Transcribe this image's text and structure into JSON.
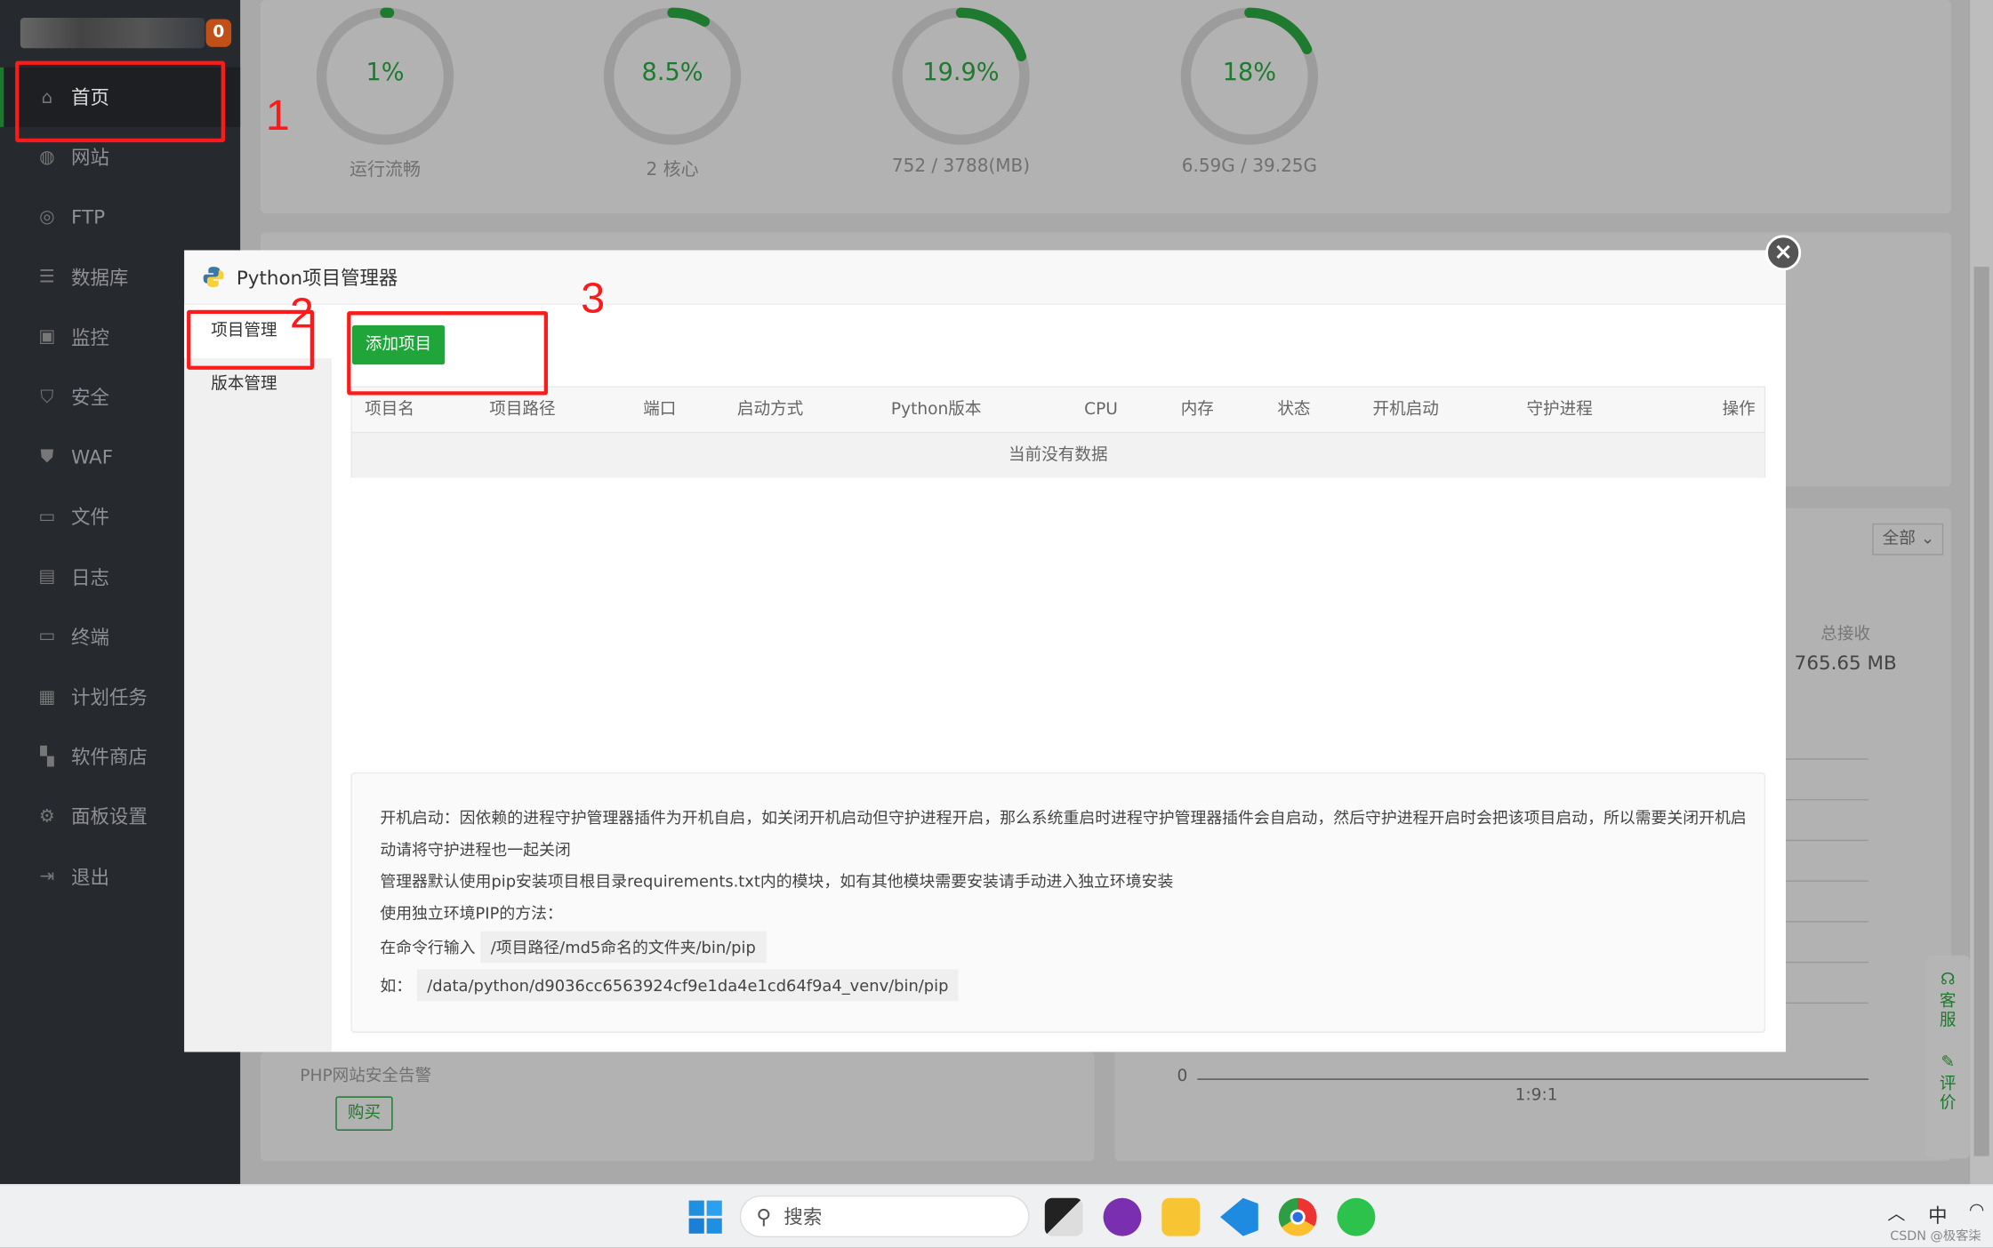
{
  "sidebar": {
    "badge": "0",
    "items": [
      {
        "label": "首页",
        "icon": "home-icon",
        "active": true
      },
      {
        "label": "网站",
        "icon": "globe-icon"
      },
      {
        "label": "FTP",
        "icon": "ftp-icon"
      },
      {
        "label": "数据库",
        "icon": "database-icon"
      },
      {
        "label": "监控",
        "icon": "monitor-icon"
      },
      {
        "label": "安全",
        "icon": "shield-icon"
      },
      {
        "label": "WAF",
        "icon": "waf-icon"
      },
      {
        "label": "文件",
        "icon": "folder-icon"
      },
      {
        "label": "日志",
        "icon": "log-icon"
      },
      {
        "label": "终端",
        "icon": "terminal-icon"
      },
      {
        "label": "计划任务",
        "icon": "calendar-icon"
      },
      {
        "label": "软件商店",
        "icon": "apps-icon"
      },
      {
        "label": "面板设置",
        "icon": "gear-icon"
      },
      {
        "label": "退出",
        "icon": "logout-icon"
      }
    ]
  },
  "gauges": [
    {
      "value": "1%",
      "percent": 1,
      "label": "运行流畅"
    },
    {
      "value": "8.5%",
      "percent": 8.5,
      "label": "2 核心"
    },
    {
      "value": "19.9%",
      "percent": 19.9,
      "label": "752 / 3788(MB)"
    },
    {
      "value": "18%",
      "percent": 18,
      "label": "6.59G / 39.25G"
    }
  ],
  "accent": "#20a53a",
  "background": {
    "select_value": "全部",
    "total_recv_label": "总接收",
    "total_recv_value": "765.65 MB",
    "php_alert": "PHP网站安全告警",
    "buy": "购买",
    "axis_zero": "0",
    "axis_ratio": "1:9:1"
  },
  "float": {
    "service": "客服",
    "review": "评价"
  },
  "modal": {
    "title": "Python项目管理器",
    "nav": [
      "项目管理",
      "版本管理"
    ],
    "add_button": "添加项目",
    "columns": [
      "项目名",
      "项目路径",
      "端口",
      "启动方式",
      "Python版本",
      "CPU",
      "内存",
      "状态",
      "开机启动",
      "守护进程",
      "操作"
    ],
    "empty": "当前没有数据",
    "help": {
      "line1": "开机启动：因依赖的进程守护管理器插件为开机自启，如关闭开机启动但守护进程开启，那么系统重启时进程守护管理器插件会自启动，然后守护进程开启时会把该项目启动，所以需要关闭开机启",
      "line2": "动请将守护进程也一起关闭",
      "line3": "管理器默认使用pip安装项目根目录requirements.txt内的模块，如有其他模块需要安装请手动进入独立环境安装",
      "line4": "使用独立环境PIP的方法：",
      "line5_prefix": "在命令行输入",
      "line5_code": "/项目路径/md5命名的文件夹/bin/pip",
      "line6_prefix": "如：",
      "line6_code": "/data/python/d9036cc6563924cf9e1da4e1cd64f9a4_venv/bin/pip"
    }
  },
  "annotations": [
    "1",
    "2",
    "3"
  ],
  "taskbar": {
    "search_placeholder": "搜索",
    "ime": "中",
    "watermark": "CSDN @极客柒"
  }
}
